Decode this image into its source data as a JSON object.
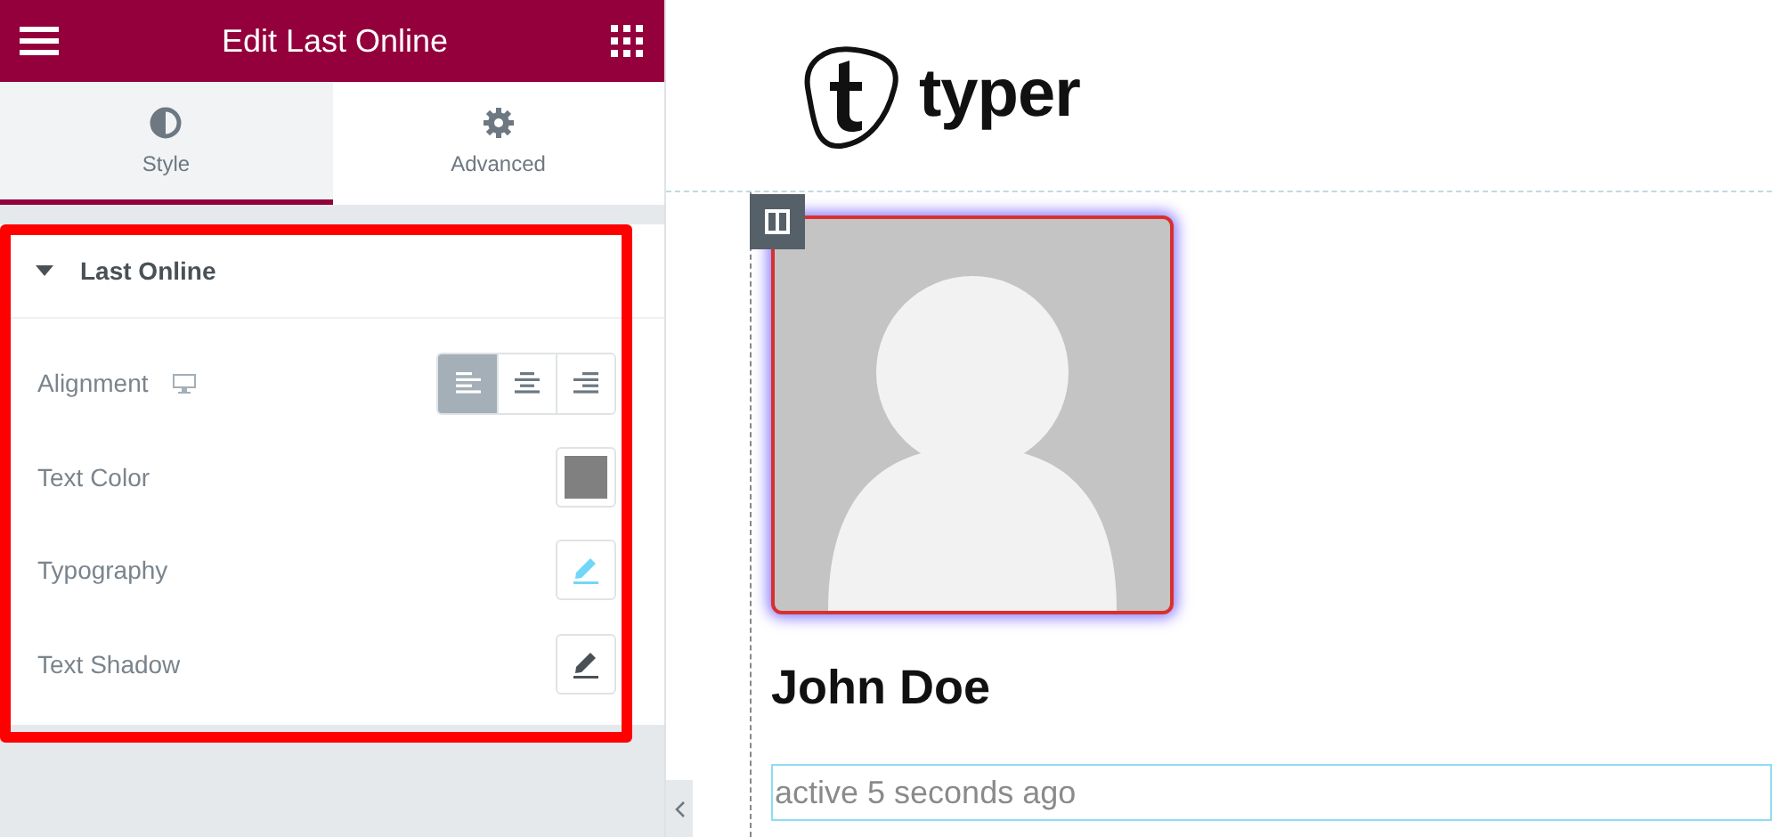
{
  "header": {
    "title": "Edit Last Online"
  },
  "tabs": [
    {
      "label": "Style",
      "selected": true
    },
    {
      "label": "Advanced",
      "selected": false
    }
  ],
  "section": {
    "title": "Last Online",
    "expanded": true,
    "highlighted": true
  },
  "controls": [
    {
      "kind": "alignment",
      "label": "Alignment",
      "options": [
        {
          "selected": true
        },
        {
          "selected": false
        },
        {
          "selected": false
        }
      ]
    },
    {
      "kind": "color",
      "label": "Text Color",
      "color": "#808080"
    },
    {
      "kind": "edit",
      "label": "Typography",
      "active": true
    },
    {
      "kind": "edit",
      "label": "Text Shadow",
      "active": false
    }
  ],
  "preview": {
    "logo": "typer",
    "name": "John Doe",
    "status": "active 5 seconds ago"
  }
}
